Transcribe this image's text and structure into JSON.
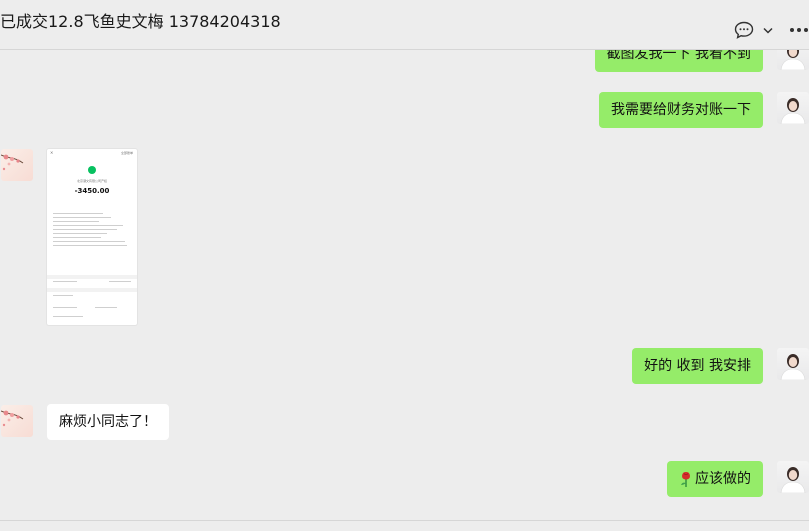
{
  "header": {
    "title": "已成交12.8飞鱼史文梅 13784204318",
    "chat_icon": "chat-bubble-icon",
    "chevron_icon": "chevron-down-icon",
    "more_icon": "more-icon"
  },
  "messages": [
    {
      "sender": "me",
      "text": "截图发我一下 我看不到"
    },
    {
      "sender": "me",
      "text": "我需要给财务对账一下"
    },
    {
      "sender": "them",
      "type": "image",
      "image": "payment-receipt-screenshot"
    },
    {
      "sender": "me",
      "text": "好的 收到 我安排"
    },
    {
      "sender": "them",
      "text": "麻烦小同志了！"
    },
    {
      "sender": "me",
      "text": "应该做的",
      "emoji_icon": "rose-icon"
    }
  ],
  "receipt": {
    "header": "全部账单",
    "merchant": "北京潮文有限公司产权",
    "amount": "-3450.00"
  },
  "colors": {
    "background": "#ededed",
    "my_bubble": "#95ec69",
    "their_bubble": "#ffffff",
    "receipt_icon": "#07c160"
  }
}
